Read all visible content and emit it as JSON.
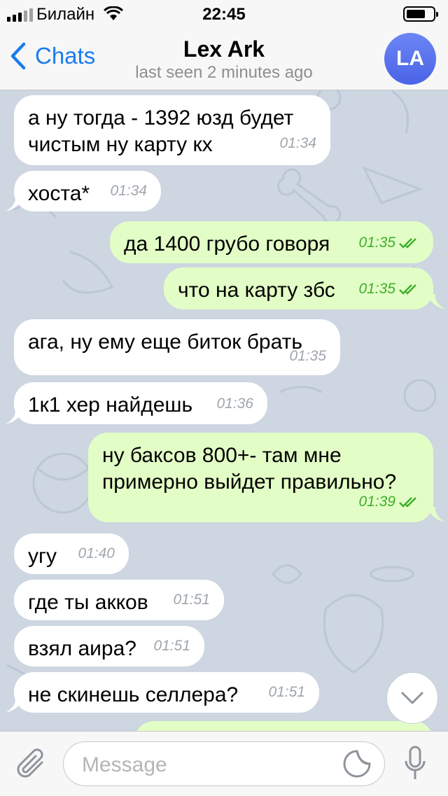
{
  "status_bar": {
    "carrier": "Билайн",
    "time": "22:45"
  },
  "nav": {
    "back_label": "Chats",
    "title": "Lex Ark",
    "subtitle": "last seen 2 minutes ago",
    "avatar_initials": "LA"
  },
  "messages": [
    {
      "direction": "in",
      "text": "а ну тогда - 1392 юзд будет\nчистым ну карту кх",
      "time": "01:34"
    },
    {
      "direction": "in",
      "text": "хоста*",
      "time": "01:34"
    },
    {
      "direction": "out",
      "text": "да 1400 грубо говоря",
      "time": "01:35",
      "read": true
    },
    {
      "direction": "out",
      "text": "что на карту збс",
      "time": "01:35",
      "read": true
    },
    {
      "direction": "in",
      "text": "ага, ну ему еще биток брать",
      "time": "01:35"
    },
    {
      "direction": "in",
      "text": "1к1 хер найдешь",
      "time": "01:36"
    },
    {
      "direction": "out",
      "text": "ну баксов 800+- там мне\nпримерно выйдет правильно?",
      "time": "01:39",
      "read": true
    },
    {
      "direction": "in",
      "text": "угу",
      "time": "01:40"
    },
    {
      "direction": "in",
      "text": "где ты акков",
      "time": "01:51"
    },
    {
      "direction": "in",
      "text": "взял аира?",
      "time": "01:51"
    },
    {
      "direction": "in",
      "text": "не скинешь селлера?",
      "time": "01:51"
    }
  ],
  "input": {
    "placeholder": "Message"
  },
  "icons": {
    "back": "chevron-left-icon",
    "attach": "paperclip-icon",
    "sticker": "sticker-icon",
    "mic": "microphone-icon",
    "scroll": "chevron-down-icon"
  },
  "colors": {
    "accent": "#1a7cf0",
    "outgoing_bubble": "#e2fec6",
    "incoming_bubble": "#ffffff",
    "read_check": "#3fae2c",
    "wallpaper": "#cdd6e1"
  }
}
